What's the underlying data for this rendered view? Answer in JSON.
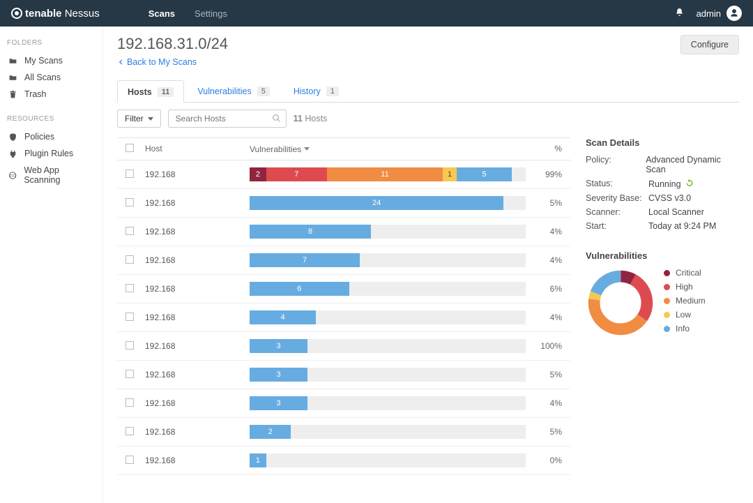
{
  "brand": {
    "name1": "tenable",
    "name2": "Nessus"
  },
  "nav": {
    "scans": "Scans",
    "settings": "Settings"
  },
  "user": {
    "name": "admin"
  },
  "sidebar": {
    "folders_label": "FOLDERS",
    "resources_label": "RESOURCES",
    "my_scans": "My Scans",
    "all_scans": "All Scans",
    "trash": "Trash",
    "policies": "Policies",
    "plugin_rules": "Plugin Rules",
    "web_app": "Web App Scanning"
  },
  "page": {
    "title": "192.168.31.0/24",
    "back": "Back to My Scans",
    "configure": "Configure"
  },
  "tabs": {
    "hosts": {
      "label": "Hosts",
      "count": "11"
    },
    "vuln": {
      "label": "Vulnerabilities",
      "count": "5"
    },
    "history": {
      "label": "History",
      "count": "1"
    }
  },
  "filter": {
    "label": "Filter",
    "search_placeholder": "Search Hosts",
    "count_num": "11",
    "count_label": " Hosts"
  },
  "columns": {
    "host": "Host",
    "vuln": "Vulnerabilities",
    "pct": "%"
  },
  "hosts": [
    {
      "ip": "192.168",
      "pct": "99%",
      "segs": [
        {
          "sev": "critical",
          "w": 6,
          "n": "2"
        },
        {
          "sev": "high",
          "w": 22,
          "n": "7"
        },
        {
          "sev": "medium",
          "w": 42,
          "n": "11"
        },
        {
          "sev": "low",
          "w": 5,
          "n": "1"
        },
        {
          "sev": "info",
          "w": 20,
          "n": "5"
        }
      ]
    },
    {
      "ip": "192.168",
      "pct": "5%",
      "segs": [
        {
          "sev": "info",
          "w": 92,
          "n": "24"
        }
      ]
    },
    {
      "ip": "192.168",
      "pct": "4%",
      "segs": [
        {
          "sev": "info",
          "w": 44,
          "n": "8"
        }
      ]
    },
    {
      "ip": "192.168",
      "pct": "4%",
      "segs": [
        {
          "sev": "info",
          "w": 40,
          "n": "7"
        }
      ]
    },
    {
      "ip": "192.168",
      "pct": "6%",
      "segs": [
        {
          "sev": "info",
          "w": 36,
          "n": "6"
        }
      ]
    },
    {
      "ip": "192.168",
      "pct": "4%",
      "segs": [
        {
          "sev": "info",
          "w": 24,
          "n": "4"
        }
      ]
    },
    {
      "ip": "192.168",
      "pct": "100%",
      "segs": [
        {
          "sev": "info",
          "w": 21,
          "n": "3"
        }
      ]
    },
    {
      "ip": "192.168",
      "pct": "5%",
      "segs": [
        {
          "sev": "info",
          "w": 21,
          "n": "3"
        }
      ]
    },
    {
      "ip": "192.168",
      "pct": "4%",
      "segs": [
        {
          "sev": "info",
          "w": 21,
          "n": "3"
        }
      ]
    },
    {
      "ip": "192.168",
      "pct": "5%",
      "segs": [
        {
          "sev": "info",
          "w": 15,
          "n": "2"
        }
      ]
    },
    {
      "ip": "192.168",
      "pct": "0%",
      "segs": [
        {
          "sev": "info",
          "w": 6,
          "n": "1"
        }
      ]
    }
  ],
  "details": {
    "title": "Scan Details",
    "rows": [
      {
        "label": "Policy:",
        "value": "Advanced Dynamic Scan"
      },
      {
        "label": "Status:",
        "value": "Running",
        "running": true
      },
      {
        "label": "Severity Base:",
        "value": "CVSS v3.0"
      },
      {
        "label": "Scanner:",
        "value": "Local Scanner"
      },
      {
        "label": "Start:",
        "value": "Today at 9:24 PM"
      }
    ]
  },
  "vuln_panel": {
    "title": "Vulnerabilities",
    "legend": {
      "critical": "Critical",
      "high": "High",
      "medium": "Medium",
      "low": "Low",
      "info": "Info"
    }
  },
  "chart_data": {
    "type": "pie",
    "title": "Vulnerabilities",
    "series": [
      {
        "name": "Critical",
        "value": 2,
        "color": "#91243E"
      },
      {
        "name": "High",
        "value": 7,
        "color": "#DD4B50"
      },
      {
        "name": "Medium",
        "value": 11,
        "color": "#F18C43"
      },
      {
        "name": "Low",
        "value": 1,
        "color": "#F8C851"
      },
      {
        "name": "Info",
        "value": 5,
        "color": "#67ACE1"
      }
    ],
    "layout": "donut"
  }
}
